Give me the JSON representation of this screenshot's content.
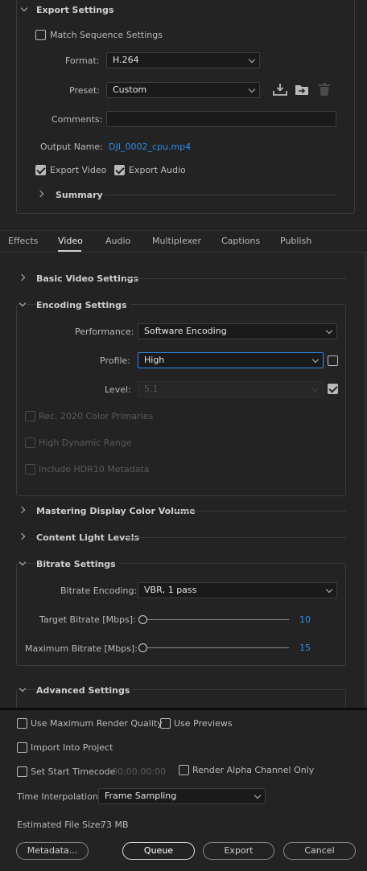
{
  "export_settings": {
    "section_title": "Export Settings",
    "match_sequence_label": "Match Sequence Settings",
    "format_label": "Format:",
    "format_value": "H.264",
    "preset_label": "Preset:",
    "preset_value": "Custom",
    "comments_label": "Comments:",
    "comments_value": "",
    "output_name_label": "Output Name:",
    "output_name_value": "DJI_0002_cpu.mp4",
    "export_video_label": "Export Video",
    "export_audio_label": "Export Audio",
    "summary_label": "Summary"
  },
  "tabs": [
    "Effects",
    "Video",
    "Audio",
    "Multiplexer",
    "Captions",
    "Publish"
  ],
  "video": {
    "basic_video_settings": "Basic Video Settings",
    "encoding_settings": "Encoding Settings",
    "performance_label": "Performance:",
    "performance_value": "Software Encoding",
    "profile_label": "Profile:",
    "profile_value": "High",
    "level_label": "Level:",
    "level_value": "5.1",
    "rec2020_label": "Rec. 2020 Color Primaries",
    "hdr_label": "High Dynamic Range",
    "hdr10_label": "Include HDR10 Metadata",
    "mastering_display": "Mastering Display Color Volume",
    "content_light": "Content Light Levels",
    "bitrate_settings": "Bitrate Settings",
    "bitrate_encoding_label": "Bitrate Encoding:",
    "bitrate_encoding_value": "VBR, 1 pass",
    "target_bitrate_label": "Target Bitrate [Mbps]:",
    "target_bitrate_value": "10",
    "max_bitrate_label": "Maximum Bitrate [Mbps]:",
    "max_bitrate_value": "15",
    "advanced_settings": "Advanced Settings"
  },
  "bottom": {
    "max_render_quality_label": "Use Maximum Render Quality",
    "use_previews_label": "Use Previews",
    "import_into_project_label": "Import Into Project",
    "set_start_timecode_label": "Set Start Timecode",
    "start_timecode_value": "00:00:00:00",
    "render_alpha_label": "Render Alpha Channel Only",
    "time_interpolation_label": "Time Interpolation:",
    "time_interpolation_value": "Frame Sampling",
    "estimated_file_size_label": "Estimated File Size:",
    "estimated_file_size_value": "73 MB",
    "metadata_button": "Metadata...",
    "queue_button": "Queue",
    "export_button": "Export",
    "cancel_button": "Cancel"
  }
}
